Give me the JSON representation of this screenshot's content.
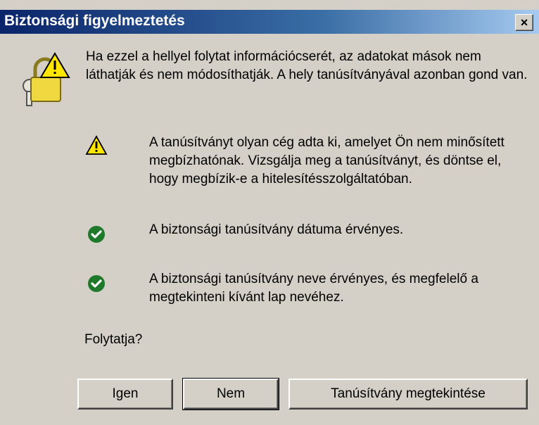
{
  "window": {
    "title": "Biztonsági figyelmeztetés",
    "close_label": "×"
  },
  "intro": "Ha ezzel a hellyel folytat információcserét, az adatokat mások nem láthatják és nem módosíthatják. A hely tanúsítványával azonban gond van.",
  "items": [
    {
      "icon": "warning-icon",
      "text": "A tanúsítványt olyan cég adta ki, amelyet Ön nem minősített megbízhatónak. Vizsgálja meg a tanúsítványt, és döntse el, hogy megbízik-e a hitelesítésszolgáltatóban."
    },
    {
      "icon": "check-icon",
      "text": "A biztonsági tanúsítvány dátuma érvényes."
    },
    {
      "icon": "check-icon",
      "text": "A biztonsági tanúsítvány neve érvényes, és megfelelő a megtekinteni kívánt lap nevéhez."
    }
  ],
  "question": "Folytatja?",
  "buttons": {
    "yes": "Igen",
    "no": "Nem",
    "view_certificate": "Tanúsítvány megtekintése"
  },
  "colors": {
    "title_start": "#0a246a",
    "title_end": "#a6caf0",
    "dialog_bg": "#d4d0c8",
    "warning": "#ffe600",
    "check": "#1e7a2a"
  }
}
